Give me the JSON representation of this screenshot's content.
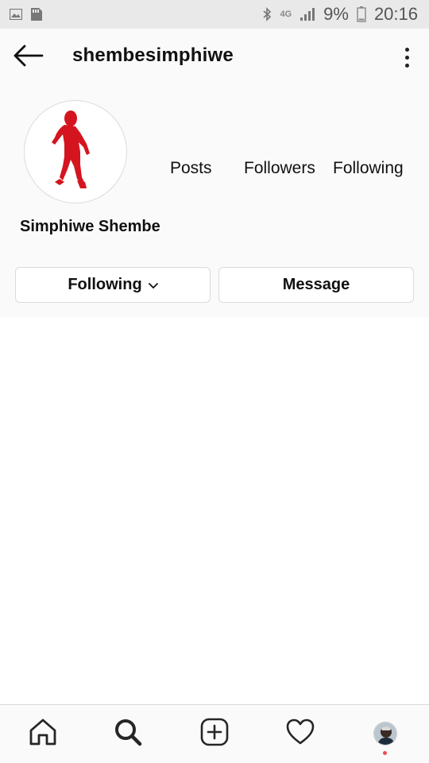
{
  "status_bar": {
    "network": "4G",
    "battery": "9%",
    "time": "20:16"
  },
  "header": {
    "username": "shembesimphiwe"
  },
  "profile": {
    "stats": {
      "posts_label": "Posts",
      "followers_label": "Followers",
      "following_label": "Following"
    },
    "display_name": "Simphiwe Shembe",
    "buttons": {
      "following_label": "Following",
      "message_label": "Message"
    }
  },
  "colors": {
    "avatar_figure": "#d4151f",
    "notification_dot": "#ed4956"
  },
  "bottom_nav": {
    "items": [
      "home-icon",
      "search-icon",
      "add-post-icon",
      "activity-heart-icon",
      "profile-avatar"
    ]
  }
}
